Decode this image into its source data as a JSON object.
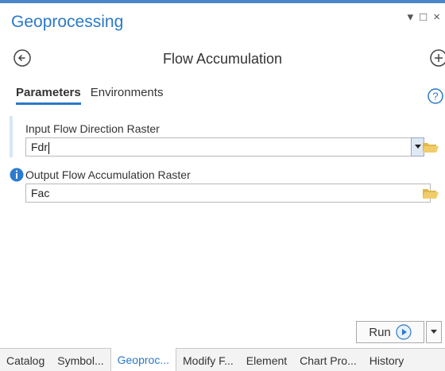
{
  "panel": {
    "title": "Geoprocessing"
  },
  "window_controls": {
    "menu": "▾",
    "maximize": "□",
    "close": "×"
  },
  "tool": {
    "title": "Flow Accumulation"
  },
  "tabs": [
    {
      "label": "Parameters",
      "active": true
    },
    {
      "label": "Environments",
      "active": false
    }
  ],
  "params": [
    {
      "label": "Input Flow Direction Raster",
      "value": "Fdr"
    },
    {
      "label": "Output Flow Accumulation Raster",
      "value": "Fac"
    }
  ],
  "run": {
    "label": "Run"
  },
  "bottom_tabs": [
    {
      "label": "Catalog"
    },
    {
      "label": "Symbol..."
    },
    {
      "label": "Geoproc...",
      "active": true
    },
    {
      "label": "Modify F..."
    },
    {
      "label": "Element"
    },
    {
      "label": "Chart Pro..."
    },
    {
      "label": "History"
    }
  ],
  "colors": {
    "accent": "#2a79c7",
    "folder": "#e1b748",
    "info": "#2b7bd0"
  },
  "icons": {
    "back": "back-arrow-circle-icon",
    "add": "plus-circle-icon",
    "help": "help-icon",
    "folder": "folder-icon",
    "info": "info-icon",
    "run": "play-icon"
  }
}
